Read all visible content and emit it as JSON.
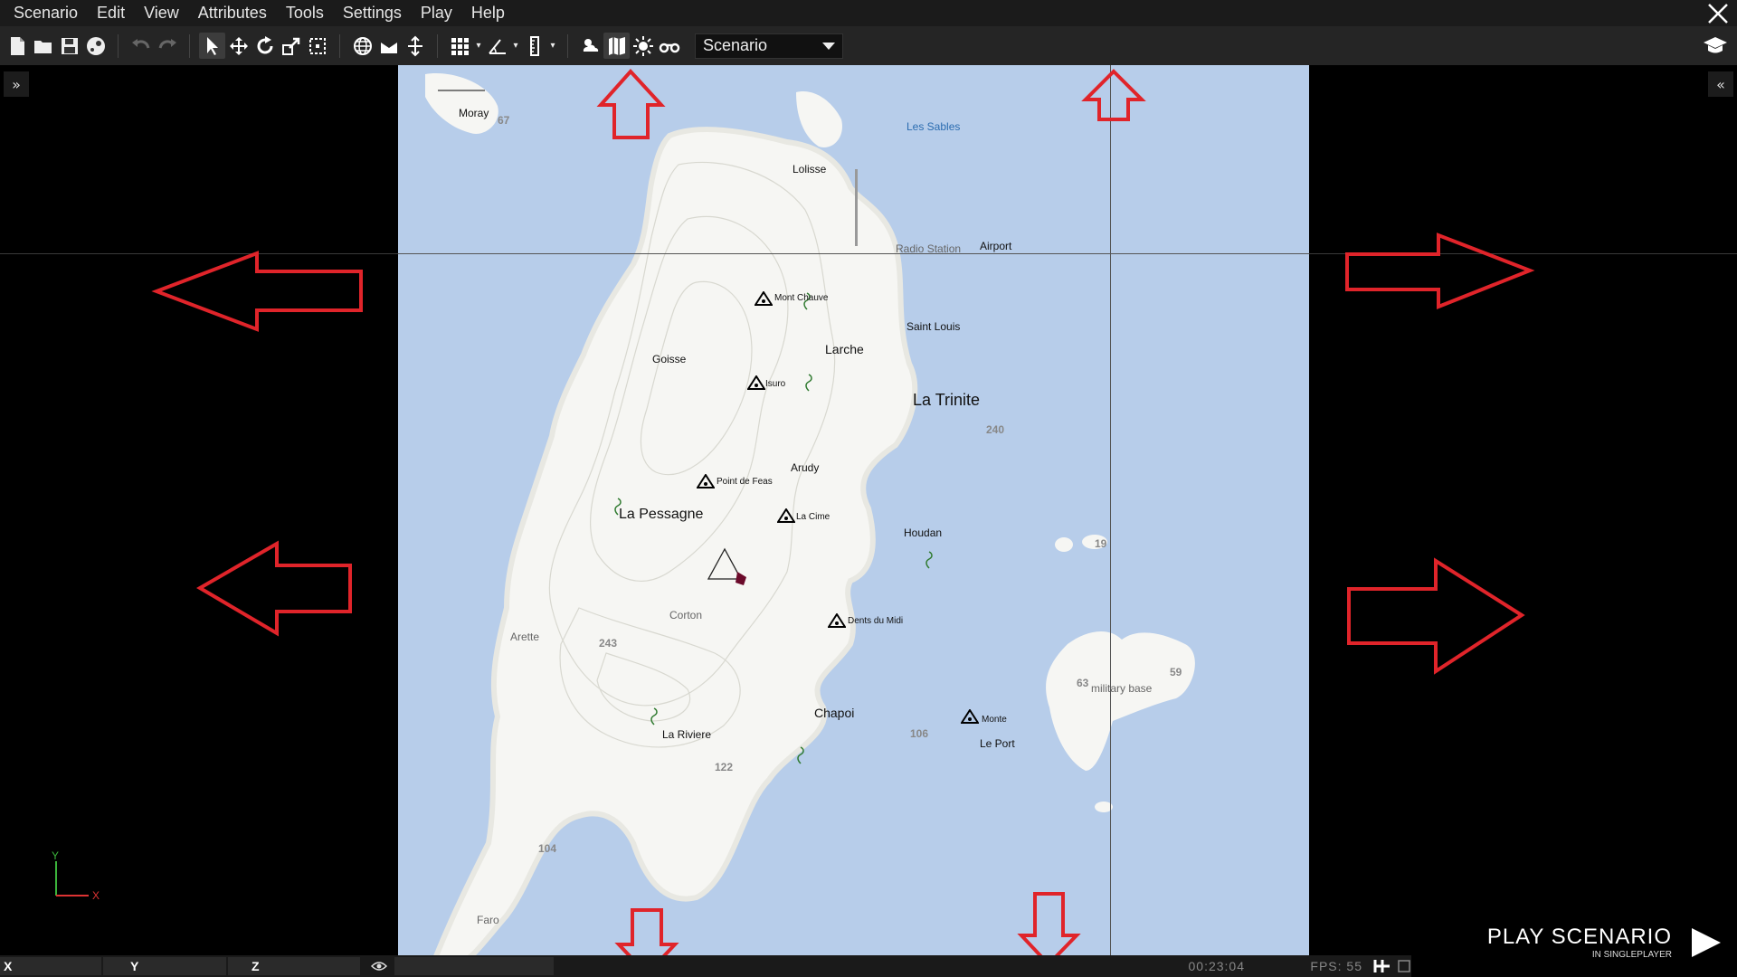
{
  "menu": [
    "Scenario",
    "Edit",
    "View",
    "Attributes",
    "Tools",
    "Settings",
    "Play",
    "Help"
  ],
  "toolbar": {
    "mode_value": "Scenario"
  },
  "icons": {
    "close": "close-icon",
    "expand_left": "»",
    "expand_right": "«"
  },
  "map": {
    "places": {
      "moray": "Moray",
      "les_sables": "Les Sables",
      "lolisse": "Lolisse",
      "radio_station": "Radio Station",
      "airport": "Airport",
      "mont_chauve": "Mont Chauve",
      "saint_louis": "Saint Louis",
      "larche": "Larche",
      "goisse": "Goisse",
      "isuro": "Isuro",
      "la_trinite": "La Trinite",
      "arudy": "Arudy",
      "point_de_feas": "Point de Feas",
      "la_pessagne": "La Pessagne",
      "la_cime": "La Cime",
      "houdan": "Houdan",
      "corton": "Corton",
      "dents_du_midi": "Dents du Midi",
      "arette": "Arette",
      "military_base": "military base",
      "chapoi": "Chapoi",
      "monte": "Monte",
      "la_riviere": "La Riviere",
      "le_port": "Le Port",
      "faro": "Faro"
    },
    "altitudes": {
      "a67": "67",
      "a240": "240",
      "a19": "19",
      "a243": "243",
      "a63": "63",
      "a59": "59",
      "a106": "106",
      "a122": "122",
      "a104": "104"
    }
  },
  "gizmo": {
    "y": "Y",
    "x": "X"
  },
  "play": {
    "title": "PLAY SCENARIO",
    "subtitle": "IN SINGLEPLAYER"
  },
  "status": {
    "x_label": "X",
    "y_label": "Y",
    "z_label": "Z",
    "time": "00:23:04",
    "fps": "FPS: 55"
  }
}
